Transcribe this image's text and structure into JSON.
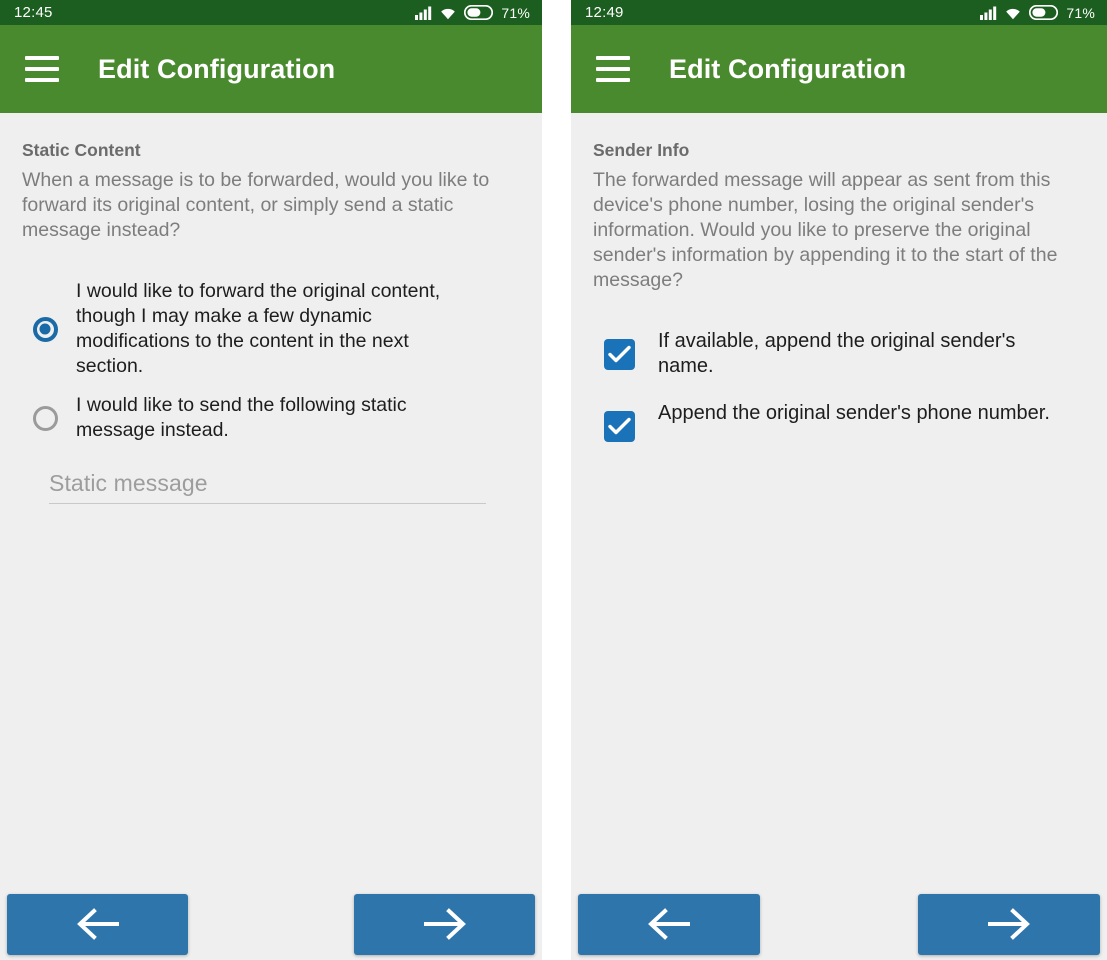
{
  "screens": [
    {
      "id": "static-content-screen",
      "status_bar": {
        "clock": "12:45",
        "battery_percent": "71%",
        "icons": [
          "signal-icon",
          "wifi-icon",
          "battery-icon"
        ]
      },
      "app_bar": {
        "menu_icon": "hamburger-menu-icon",
        "title": "Edit Configuration"
      },
      "section": {
        "title": "Static Content",
        "description": "When a message is to be forwarded, would you like to forward its original content, or simply send a static message instead?"
      },
      "radio_options": [
        {
          "label": "I would like to forward the original content, though I may make a few dynamic modifications to the content in the next section.",
          "checked": true
        },
        {
          "label": "I would like to send the following static message instead.",
          "checked": false
        }
      ],
      "static_message_field": {
        "placeholder": "Static message",
        "value": ""
      },
      "bottom_nav": {
        "back_icon": "arrow-left-icon",
        "next_icon": "arrow-right-icon"
      }
    },
    {
      "id": "sender-info-screen",
      "status_bar": {
        "clock": "12:49",
        "battery_percent": "71%",
        "icons": [
          "signal-icon",
          "wifi-icon",
          "battery-icon"
        ]
      },
      "app_bar": {
        "menu_icon": "hamburger-menu-icon",
        "title": "Edit Configuration"
      },
      "section": {
        "title": "Sender Info",
        "description": "The forwarded message will appear as sent from this device's phone number, losing the original sender's information. Would you like to preserve the original sender's information by appending it to the start of the message?"
      },
      "checkbox_options": [
        {
          "label": "If available, append the original sender's name.",
          "checked": true
        },
        {
          "label": "Append the original sender's phone number.",
          "checked": true
        }
      ],
      "bottom_nav": {
        "back_icon": "arrow-left-icon",
        "next_icon": "arrow-right-icon"
      }
    }
  ],
  "colors": {
    "status_bar": "#1c5e20",
    "app_bar": "#4a8a2f",
    "page_background": "#efefef",
    "accent_blue": "#1a72b8",
    "button_blue": "#2d75ab",
    "radio_selected": "#1a6aa8"
  }
}
